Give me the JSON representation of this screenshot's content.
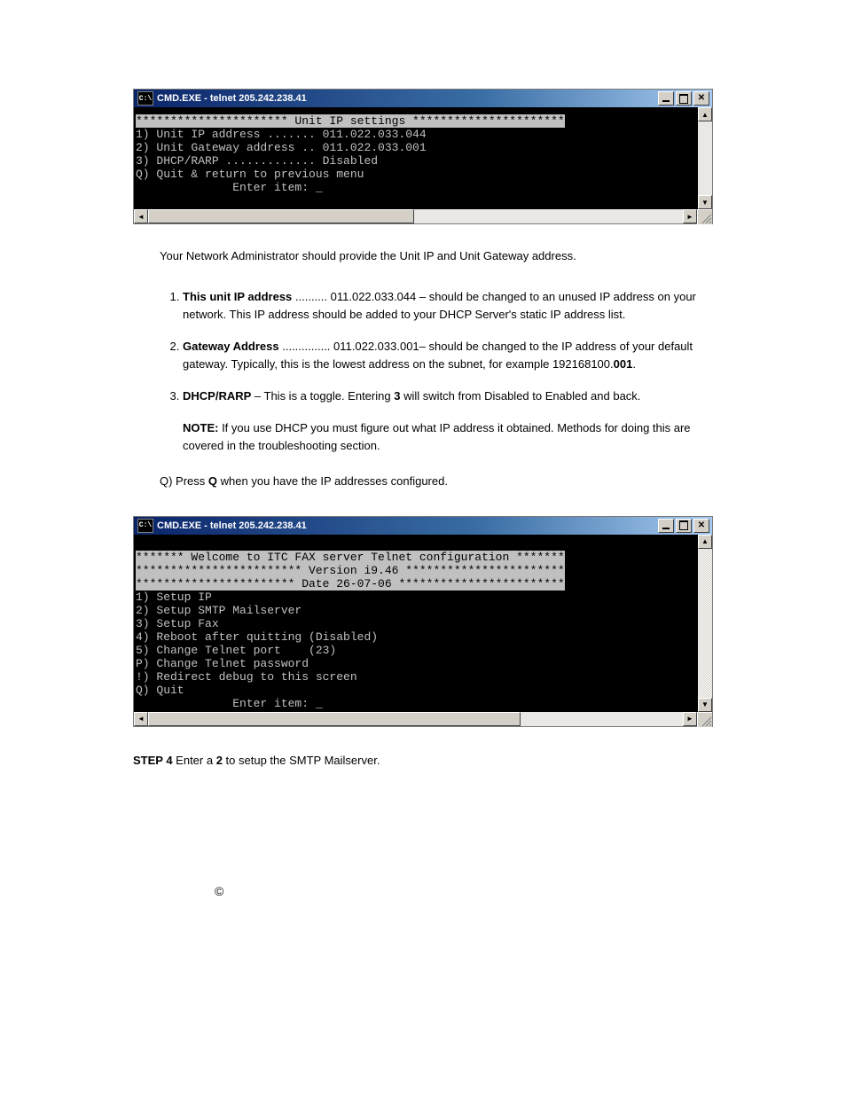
{
  "win1": {
    "title": "CMD.EXE - telnet 205.242.238.41",
    "header": "********************** Unit IP settings **********************",
    "lines": [
      "1) Unit IP address ....... 011.022.033.044",
      "2) Unit Gateway address .. 011.022.033.001",
      "3) DHCP/RARP ............. Disabled",
      "Q) Quit & return to previous menu",
      "              Enter item: _"
    ]
  },
  "win2": {
    "title": "CMD.EXE - telnet 205.242.238.41",
    "h1": "******* Welcome to ITC FAX server Telnet configuration *******",
    "h2": "************************ Version i9.46 ***********************",
    "h3": "*********************** Date 26-07-06 ************************",
    "lines": [
      "1) Setup IP",
      "2) Setup SMTP Mailserver",
      "3) Setup Fax",
      "4) Reboot after quitting (Disabled)",
      "5) Change Telnet port    (23)",
      "P) Change Telnet password",
      "!) Redirect debug to this screen",
      "Q) Quit",
      "              Enter item: _"
    ]
  },
  "intro": "Your Network Administrator should provide the Unit IP and Unit Gateway address.",
  "item1": {
    "label": "This unit IP address",
    "dots": " .......... 011.022.033.044 – should be changed to an unused IP address on your network. This IP address should be added to your DHCP Server's static IP address list."
  },
  "item2": {
    "label": "Gateway Address",
    "dots": " ............... 011.022.033.001– should be changed to the IP address of your default gateway. Typically, this is the lowest address on the subnet, for example 192168100.",
    "bold_tail": "001",
    "tail": "."
  },
  "item3": {
    "label": "DHCP/RARP",
    "text1": " – This is a toggle. Entering ",
    "bold3": "3",
    "text2": " will switch from Disabled to Enabled and back."
  },
  "note": {
    "label": "NOTE:",
    "text": "  If you use DHCP you must figure out what IP address it obtained. Methods for doing this are covered in the troubleshooting section."
  },
  "q": {
    "prefix": "Q)  Press ",
    "bold": "Q",
    "suffix": " when you have the IP addresses configured."
  },
  "step4": {
    "label": "STEP 4",
    "t1": " Enter a ",
    "b": "2",
    "t2": " to setup the SMTP Mailserver."
  },
  "copyright": "©"
}
